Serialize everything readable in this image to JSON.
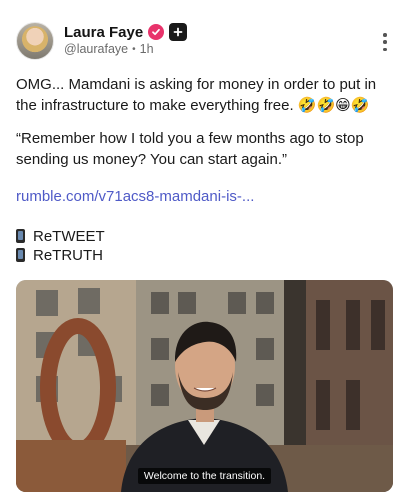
{
  "author": {
    "display_name": "Laura Faye",
    "handle": "@laurafaye",
    "separator": "•",
    "time": "1h"
  },
  "post": {
    "paragraph1": "OMG... Mamdani is asking for money in order to put in the infrastructure to make everything free. 🤣🤣😁🤣",
    "paragraph2": "“Remember how I told you a few months ago to stop sending us money? You can start again.”",
    "link_text": "rumble.com/v71acs8-mamdani-is-...",
    "tag1": "ReTWEET",
    "tag2": "ReTRUTH"
  },
  "video": {
    "caption": "Welcome to the transition."
  },
  "icons": {
    "verified": "verified-check-icon",
    "plus": "plus-badge-icon",
    "more": "more-vertical-icon",
    "phone": "mobile-phone-icon"
  },
  "colors": {
    "link": "#4f5ac7",
    "verified_badge": "#e8336b",
    "meta_text": "#6b6b6b"
  }
}
